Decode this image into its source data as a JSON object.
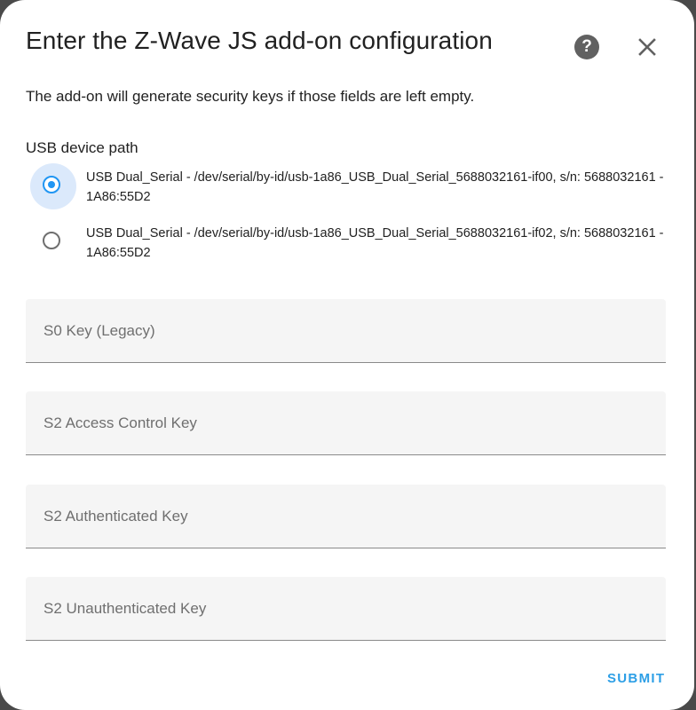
{
  "dialog": {
    "title": "Enter the Z-Wave JS add-on configuration",
    "help_icon": "help-circle-icon",
    "help_glyph": "?",
    "close_icon": "close-icon",
    "description": "The add-on will generate security keys if those fields are left empty."
  },
  "usb": {
    "label": "USB device path",
    "options": [
      {
        "text": "USB Dual_Serial - /dev/serial/by-id/usb-1a86_USB_Dual_Serial_5688032161-if00, s/n: 5688032161 - 1A86:55D2",
        "selected": true
      },
      {
        "text": "USB Dual_Serial - /dev/serial/by-id/usb-1a86_USB_Dual_Serial_5688032161-if02, s/n: 5688032161 - 1A86:55D2",
        "selected": false
      }
    ]
  },
  "fields": [
    {
      "placeholder": "S0 Key (Legacy)",
      "value": ""
    },
    {
      "placeholder": "S2 Access Control Key",
      "value": ""
    },
    {
      "placeholder": "S2 Authenticated Key",
      "value": ""
    },
    {
      "placeholder": "S2 Unauthenticated Key",
      "value": ""
    }
  ],
  "actions": {
    "submit_label": "SUBMIT"
  },
  "colors": {
    "accent": "#2196f3",
    "submit": "#2d9fe6",
    "field_bg": "#f5f5f5"
  }
}
